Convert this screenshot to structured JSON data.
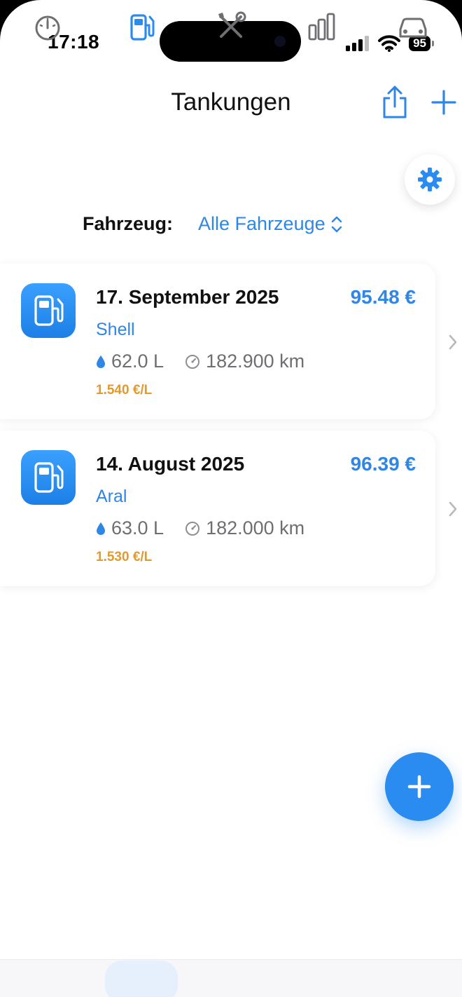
{
  "status": {
    "time": "17:18",
    "battery": "95"
  },
  "nav": {
    "title": "Tankungen"
  },
  "filter": {
    "label": "Fahrzeug:",
    "value": "Alle Fahrzeuge"
  },
  "entries": [
    {
      "date": "17. September 2025",
      "amount": "95.48 €",
      "station": "Shell",
      "liters": "62.0 L",
      "odometer": "182.900 km",
      "price_per_liter": "1.540 €/L"
    },
    {
      "date": "14. August 2025",
      "amount": "96.39 €",
      "station": "Aral",
      "liters": "63.0 L",
      "odometer": "182.000 km",
      "price_per_liter": "1.530 €/L"
    }
  ],
  "tabs": [
    {
      "icon": "speedometer-icon",
      "active": false
    },
    {
      "icon": "fuel-pump-icon",
      "active": true
    },
    {
      "icon": "tools-icon",
      "active": false
    },
    {
      "icon": "bar-chart-icon",
      "active": false
    },
    {
      "icon": "car-icon",
      "active": false
    }
  ],
  "colors": {
    "accent": "#2f86e6",
    "price": "#e39a2a",
    "secondary_text": "#6e6e73"
  }
}
